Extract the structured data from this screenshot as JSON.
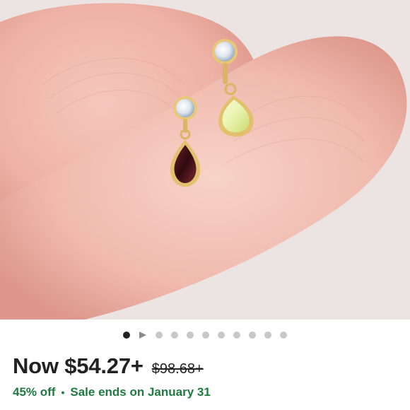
{
  "product": {
    "image_alt": "Gold stud earrings with moonstone and pear-shaped drop gems held on a fingertip"
  },
  "carousel": {
    "dot_count": 11,
    "active_index": 0,
    "video_index": 1
  },
  "pricing": {
    "now_label": "Now $54.27+",
    "original_price": "$98.68+",
    "discount": "45% off",
    "separator": "•",
    "sale_ends": "Sale ends on January 31"
  },
  "colors": {
    "sale_green": "#1f7a3f",
    "active_dot": "#222222",
    "inactive_dot": "#c8c8c8"
  }
}
